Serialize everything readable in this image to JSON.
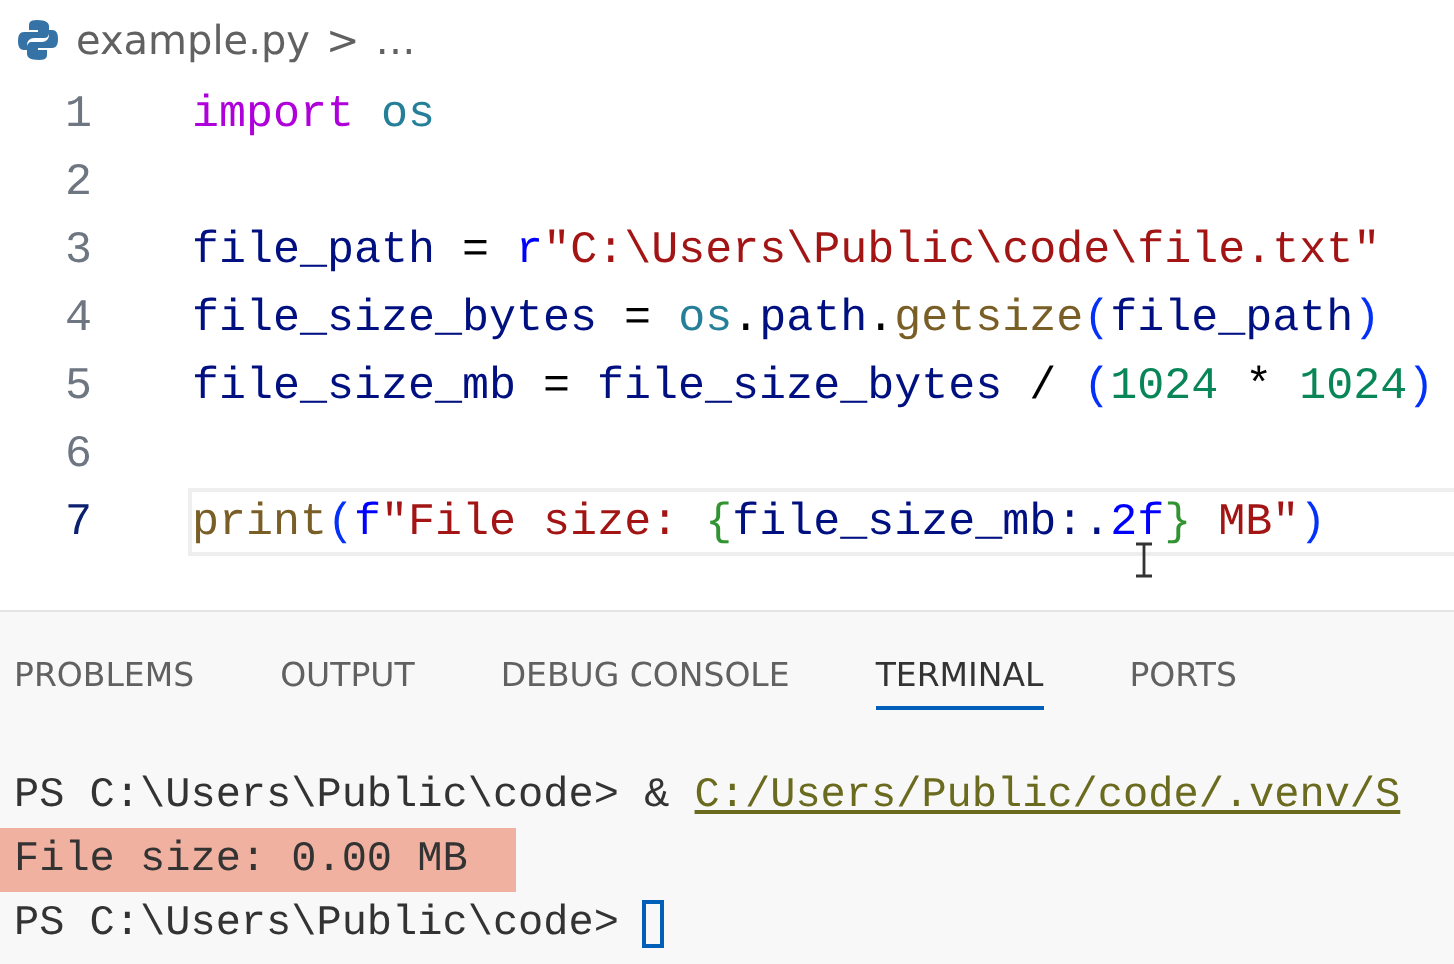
{
  "breadcrumb": {
    "file": "example.py",
    "separator": ">",
    "more": "…"
  },
  "code_lines": [
    {
      "number": "1",
      "current": false,
      "tokens": [
        {
          "kind": "keyword",
          "text": "import"
        },
        {
          "kind": "module",
          "text": " os"
        }
      ]
    },
    {
      "number": "2",
      "current": false
    },
    {
      "number": "3",
      "current": false,
      "tokens": [
        {
          "kind": "variable",
          "text": "file_path"
        },
        {
          "kind": "plain",
          "text": " = "
        },
        {
          "kind": "prefix",
          "text": "r"
        },
        {
          "kind": "string",
          "text": "\"C:\\Users\\Public\\code\\file.txt\""
        }
      ]
    },
    {
      "number": "4",
      "current": false,
      "tokens": [
        {
          "kind": "variable",
          "text": "file_size_bytes"
        },
        {
          "kind": "plain",
          "text": " = "
        },
        {
          "kind": "module",
          "text": "os"
        },
        {
          "kind": "plain",
          "text": "."
        },
        {
          "kind": "variable",
          "text": "path"
        },
        {
          "kind": "plain",
          "text": "."
        },
        {
          "kind": "function",
          "text": "getsize"
        },
        {
          "kind": "bracket",
          "text": "("
        },
        {
          "kind": "variable",
          "text": "file_path"
        },
        {
          "kind": "bracket",
          "text": ")"
        }
      ]
    },
    {
      "number": "5",
      "current": false,
      "tokens": [
        {
          "kind": "variable",
          "text": "file_size_mb"
        },
        {
          "kind": "plain",
          "text": " = "
        },
        {
          "kind": "variable",
          "text": "file_size_bytes"
        },
        {
          "kind": "plain",
          "text": " / "
        },
        {
          "kind": "bracket",
          "text": "("
        },
        {
          "kind": "number",
          "text": "1024"
        },
        {
          "kind": "plain",
          "text": " * "
        },
        {
          "kind": "number",
          "text": "1024"
        },
        {
          "kind": "bracket",
          "text": ")"
        }
      ]
    },
    {
      "number": "6",
      "current": false
    },
    {
      "number": "7",
      "current": true,
      "tokens": [
        {
          "kind": "function",
          "text": "print"
        },
        {
          "kind": "bracket",
          "text": "("
        },
        {
          "kind": "prefix",
          "text": "f"
        },
        {
          "kind": "string",
          "text": "\"File size: "
        },
        {
          "kind": "brace",
          "text": "{"
        },
        {
          "kind": "variable",
          "text": "file_size_mb:."
        },
        {
          "kind": "prefix",
          "text": "2f"
        },
        {
          "kind": "brace",
          "text": "}"
        },
        {
          "kind": "string",
          "text": " MB\""
        },
        {
          "kind": "bracket",
          "text": ")"
        }
      ]
    }
  ],
  "panel_tabs": [
    {
      "label": "PROBLEMS",
      "selected": false
    },
    {
      "label": "OUTPUT",
      "selected": false
    },
    {
      "label": "DEBUG CONSOLE",
      "selected": false
    },
    {
      "label": "TERMINAL",
      "selected": true
    },
    {
      "label": "PORTS",
      "selected": false
    }
  ],
  "terminal_lines": [
    {
      "kind": "prompt",
      "prompt": "PS C:\\Users\\Public\\code>",
      "command": "&",
      "link": "C:/Users/Public/code/.venv/S",
      "highlighted": false
    },
    {
      "kind": "output",
      "text": "File size: 0.00 MB",
      "highlighted": true
    },
    {
      "kind": "prompt",
      "prompt": "PS C:\\Users\\Public\\code>",
      "cursor": true,
      "highlighted": false
    }
  ]
}
